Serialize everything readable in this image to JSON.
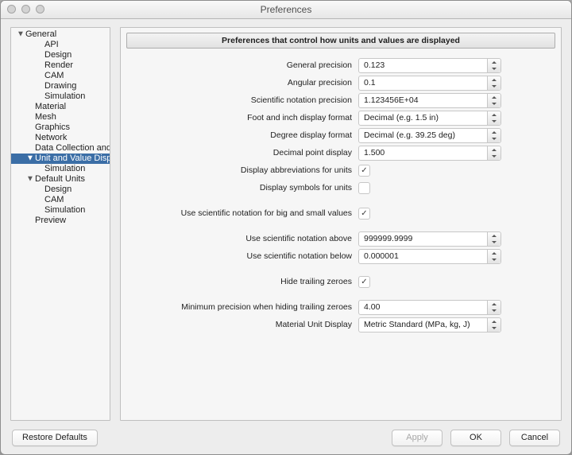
{
  "window": {
    "title": "Preferences"
  },
  "tree": {
    "items": [
      {
        "label": "General",
        "depth": 0,
        "arrow": "down",
        "selected": false
      },
      {
        "label": "API",
        "depth": 2,
        "arrow": "none",
        "selected": false
      },
      {
        "label": "Design",
        "depth": 2,
        "arrow": "none",
        "selected": false
      },
      {
        "label": "Render",
        "depth": 2,
        "arrow": "none",
        "selected": false
      },
      {
        "label": "CAM",
        "depth": 2,
        "arrow": "none",
        "selected": false
      },
      {
        "label": "Drawing",
        "depth": 2,
        "arrow": "none",
        "selected": false
      },
      {
        "label": "Simulation",
        "depth": 2,
        "arrow": "none",
        "selected": false
      },
      {
        "label": "Material",
        "depth": 1,
        "arrow": "none",
        "selected": false
      },
      {
        "label": "Mesh",
        "depth": 1,
        "arrow": "none",
        "selected": false
      },
      {
        "label": "Graphics",
        "depth": 1,
        "arrow": "none",
        "selected": false
      },
      {
        "label": "Network",
        "depth": 1,
        "arrow": "none",
        "selected": false
      },
      {
        "label": "Data Collection and Use",
        "depth": 1,
        "arrow": "none",
        "selected": false
      },
      {
        "label": "Unit and Value Display",
        "depth": 1,
        "arrow": "down",
        "selected": true
      },
      {
        "label": "Simulation",
        "depth": 2,
        "arrow": "none",
        "selected": false
      },
      {
        "label": "Default Units",
        "depth": 1,
        "arrow": "down",
        "selected": false
      },
      {
        "label": "Design",
        "depth": 2,
        "arrow": "none",
        "selected": false
      },
      {
        "label": "CAM",
        "depth": 2,
        "arrow": "none",
        "selected": false
      },
      {
        "label": "Simulation",
        "depth": 2,
        "arrow": "none",
        "selected": false
      },
      {
        "label": "Preview",
        "depth": 1,
        "arrow": "none",
        "selected": false
      }
    ]
  },
  "main": {
    "banner": "Preferences that control how units and values are displayed",
    "rows": [
      {
        "type": "select",
        "label": "General precision",
        "value": "0.123"
      },
      {
        "type": "select",
        "label": "Angular precision",
        "value": "0.1"
      },
      {
        "type": "select",
        "label": "Scientific notation precision",
        "value": "1.123456E+04"
      },
      {
        "type": "select",
        "label": "Foot and inch display format",
        "value": "Decimal (e.g. 1.5 in)"
      },
      {
        "type": "select",
        "label": "Degree display format",
        "value": "Decimal (e.g. 39.25 deg)"
      },
      {
        "type": "select",
        "label": "Decimal point display",
        "value": "1.500"
      },
      {
        "type": "checkbox",
        "label": "Display abbreviations for units",
        "checked": true
      },
      {
        "type": "checkbox",
        "label": "Display symbols for units",
        "checked": false
      },
      {
        "type": "gap"
      },
      {
        "type": "checkbox",
        "label": "Use scientific notation for big and small values",
        "checked": true
      },
      {
        "type": "gap"
      },
      {
        "type": "text",
        "label": "Use scientific notation above",
        "value": "999999.9999"
      },
      {
        "type": "text",
        "label": "Use scientific notation below",
        "value": "0.000001"
      },
      {
        "type": "gap"
      },
      {
        "type": "checkbox",
        "label": "Hide trailing zeroes",
        "checked": true
      },
      {
        "type": "gap"
      },
      {
        "type": "select",
        "label": "Minimum precision when hiding trailing zeroes",
        "value": "4.00"
      },
      {
        "type": "select",
        "label": "Material Unit Display",
        "value": "Metric Standard (MPa, kg, J)"
      }
    ]
  },
  "footer": {
    "restore": "Restore Defaults",
    "apply": "Apply",
    "ok": "OK",
    "cancel": "Cancel"
  }
}
